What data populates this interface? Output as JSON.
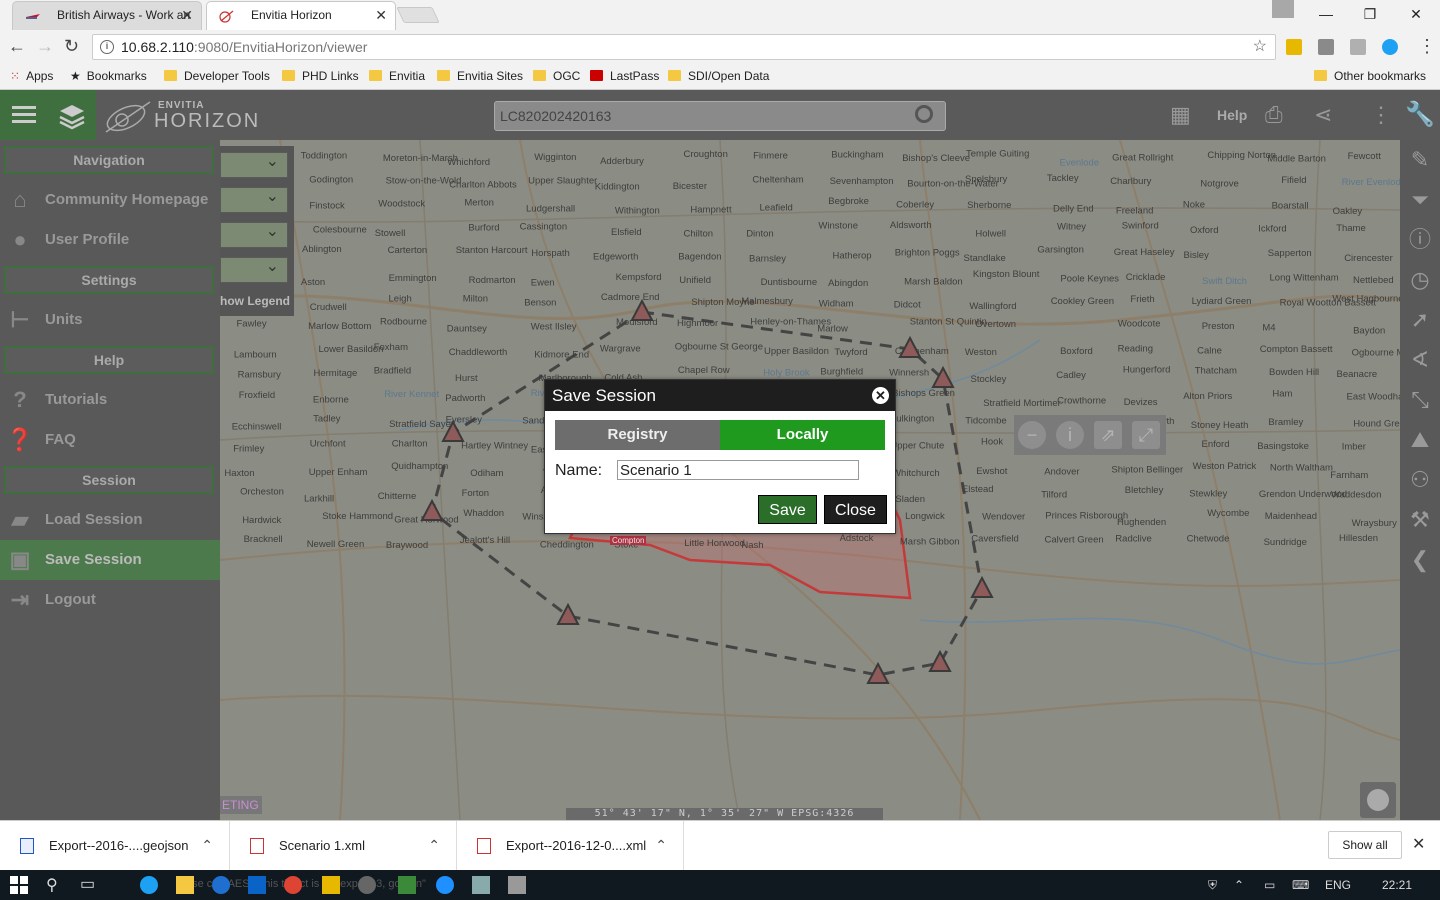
{
  "browser": {
    "tabs": [
      {
        "label": "British Airways - Work an"
      },
      {
        "label": "Envitia Horizon"
      }
    ],
    "url": {
      "host": "10.68.2.110",
      "rest": ":9080/EnvitiaHorizon/viewer"
    },
    "bookmarks": [
      {
        "label": "Apps"
      },
      {
        "label": "Bookmarks"
      },
      {
        "label": "Developer Tools"
      },
      {
        "label": "PHD Links"
      },
      {
        "label": "Envitia"
      },
      {
        "label": "Envitia Sites"
      },
      {
        "label": "OGC"
      },
      {
        "label": "LastPass"
      },
      {
        "label": "SDI/Open Data"
      },
      {
        "label": "Other bookmarks"
      }
    ]
  },
  "header": {
    "brand_small": "ENVITIA",
    "brand": "HORIZON",
    "search_value": "LC820202420163",
    "help_label": "Help"
  },
  "sidebar": {
    "sections": {
      "navigation": "Navigation",
      "settings": "Settings",
      "help": "Help",
      "session": "Session"
    },
    "items": {
      "community": "Community Homepage",
      "profile": "User Profile",
      "units": "Units",
      "tutorials": "Tutorials",
      "faq": "FAQ",
      "load": "Load Session",
      "save": "Save Session",
      "logout": "Logout"
    }
  },
  "map": {
    "show_legend": "how Legend",
    "coords": "51° 43' 17\" N,   1° 35' 27\" W    EPSG:4326",
    "eting": "ETING",
    "places": [
      {
        "name": "Alstone"
      },
      {
        "name": "Toddington"
      },
      {
        "name": "Moreton-in-Marsh"
      },
      {
        "name": "Whichford"
      },
      {
        "name": "Wigginton"
      },
      {
        "name": "Adderbury"
      },
      {
        "name": "Croughton"
      },
      {
        "name": "Finmere"
      },
      {
        "name": "Buckingham"
      },
      {
        "name": "Bishop's Cleeve"
      },
      {
        "name": "Temple Guiting"
      },
      {
        "name": "Evenlode"
      },
      {
        "name": "Great Rollright"
      },
      {
        "name": "Chipping Norton"
      },
      {
        "name": "Middle Barton"
      },
      {
        "name": "Fewcott"
      },
      {
        "name": "Newton Morrell"
      },
      {
        "name": "Godington"
      },
      {
        "name": "Stow-on-the-Wold"
      },
      {
        "name": "Charlton Abbots"
      },
      {
        "name": "Upper Slaughter"
      },
      {
        "name": "Kiddington"
      },
      {
        "name": "Bicester"
      },
      {
        "name": "Cheltenham"
      },
      {
        "name": "Sevenhampton"
      },
      {
        "name": "Bourton-on-the-Water"
      },
      {
        "name": "Spelsbury"
      },
      {
        "name": "Tackley"
      },
      {
        "name": "Charlbury"
      },
      {
        "name": "Notgrove"
      },
      {
        "name": "Fifield"
      },
      {
        "name": "River Evenlode"
      },
      {
        "name": "Shipton"
      },
      {
        "name": "Finstock"
      },
      {
        "name": "Woodstock"
      },
      {
        "name": "Merton"
      },
      {
        "name": "Ludgershall"
      },
      {
        "name": "Withington"
      },
      {
        "name": "Hampnett"
      },
      {
        "name": "Leafield"
      },
      {
        "name": "Begbroke"
      },
      {
        "name": "Coberley"
      },
      {
        "name": "Sherborne"
      },
      {
        "name": "Delly End"
      },
      {
        "name": "Freeland"
      },
      {
        "name": "Noke"
      },
      {
        "name": "Boarstall"
      },
      {
        "name": "Oakley"
      },
      {
        "name": "Aylesbury"
      },
      {
        "name": "Colesbourne"
      },
      {
        "name": "Stowell"
      },
      {
        "name": "Burford"
      },
      {
        "name": "Cassington"
      },
      {
        "name": "Elsfield"
      },
      {
        "name": "Chilton"
      },
      {
        "name": "Dinton"
      },
      {
        "name": "Winstone"
      },
      {
        "name": "Aldsworth"
      },
      {
        "name": "Holwell"
      },
      {
        "name": "Witney"
      },
      {
        "name": "Swinford"
      },
      {
        "name": "Oxford"
      },
      {
        "name": "Ickford"
      },
      {
        "name": "Thame"
      },
      {
        "name": "Calmsden"
      },
      {
        "name": "Ablington"
      },
      {
        "name": "Carterton"
      },
      {
        "name": "Stanton Harcourt"
      },
      {
        "name": "Horspath"
      },
      {
        "name": "Edgeworth"
      },
      {
        "name": "Bagendon"
      },
      {
        "name": "Barnsley"
      },
      {
        "name": "Hatherop"
      },
      {
        "name": "Brighton Poggs"
      },
      {
        "name": "Standlake"
      },
      {
        "name": "Garsington"
      },
      {
        "name": "Great Haseley"
      },
      {
        "name": "Bisley"
      },
      {
        "name": "Sapperton"
      },
      {
        "name": "Cirencester"
      },
      {
        "name": "Coates"
      },
      {
        "name": "Aston"
      },
      {
        "name": "Emmington"
      },
      {
        "name": "Rodmarton"
      },
      {
        "name": "Ewen"
      },
      {
        "name": "Kempsford"
      },
      {
        "name": "Unifield"
      },
      {
        "name": "Duntisbourne"
      },
      {
        "name": "Abingdon"
      },
      {
        "name": "Marsh Baldon"
      },
      {
        "name": "Kingston Blount"
      },
      {
        "name": "Poole Keynes"
      },
      {
        "name": "Cricklade"
      },
      {
        "name": "Swift Ditch"
      },
      {
        "name": "Long Wittenham"
      },
      {
        "name": "Nettlebed"
      },
      {
        "name": "Tetbury"
      },
      {
        "name": "Crudwell"
      },
      {
        "name": "Leigh"
      },
      {
        "name": "Milton"
      },
      {
        "name": "Benson"
      },
      {
        "name": "Cadmore End"
      },
      {
        "name": "Shipton Moyne"
      },
      {
        "name": "Malmesbury"
      },
      {
        "name": "Widham"
      },
      {
        "name": "Didcot"
      },
      {
        "name": "Wallingford"
      },
      {
        "name": "Cookley Green"
      },
      {
        "name": "Frieth"
      },
      {
        "name": "Lydiard Green"
      },
      {
        "name": "Royal Wootton Bassett"
      },
      {
        "name": "West Hagbourne"
      },
      {
        "name": "Fawley"
      },
      {
        "name": "Marlow Bottom"
      },
      {
        "name": "Rodbourne"
      },
      {
        "name": "Dauntsey"
      },
      {
        "name": "West Ilsley"
      },
      {
        "name": "Moulsford"
      },
      {
        "name": "Highmoor"
      },
      {
        "name": "Henley-on-Thames"
      },
      {
        "name": "Marlow"
      },
      {
        "name": "Stanton St Quintin"
      },
      {
        "name": "Overtown"
      },
      {
        "name": "Compton"
      },
      {
        "name": "Woodcote"
      },
      {
        "name": "Preston"
      },
      {
        "name": "M4"
      },
      {
        "name": "Baydon"
      },
      {
        "name": "Lambourn"
      },
      {
        "name": "Lower Basildon"
      },
      {
        "name": "Foxham"
      },
      {
        "name": "Chaddleworth"
      },
      {
        "name": "Kidmore End"
      },
      {
        "name": "Wargrave"
      },
      {
        "name": "Ogbourne St George"
      },
      {
        "name": "Upper Basildon"
      },
      {
        "name": "Twyford"
      },
      {
        "name": "Chippenham"
      },
      {
        "name": "Weston"
      },
      {
        "name": "Boxford"
      },
      {
        "name": "Reading"
      },
      {
        "name": "Calne"
      },
      {
        "name": "Compton Bassett"
      },
      {
        "name": "Ogbourne Maizey"
      },
      {
        "name": "Ramsbury"
      },
      {
        "name": "Hermitage"
      },
      {
        "name": "Bradfield"
      },
      {
        "name": "Hurst"
      },
      {
        "name": "Marlborough"
      },
      {
        "name": "Cold Ash"
      },
      {
        "name": "Chapel Row"
      },
      {
        "name": "Holy Brook"
      },
      {
        "name": "Burghfield"
      },
      {
        "name": "Winnersh"
      },
      {
        "name": "Stockley"
      },
      {
        "name": "Cadley"
      },
      {
        "name": "Hungerford"
      },
      {
        "name": "Thatcham"
      },
      {
        "name": "Bowden Hill"
      },
      {
        "name": "Beanacre"
      },
      {
        "name": "Froxfield"
      },
      {
        "name": "Enborne"
      },
      {
        "name": "River Kennet"
      },
      {
        "name": "Padworth"
      },
      {
        "name": "River Loddon"
      },
      {
        "name": "Barkham"
      },
      {
        "name": "Melksham"
      },
      {
        "name": "Chisbury"
      },
      {
        "name": "Inkpen"
      },
      {
        "name": "Bishops Green"
      },
      {
        "name": "Stratfield Mortimer"
      },
      {
        "name": "Crowthorne"
      },
      {
        "name": "Devizes"
      },
      {
        "name": "Alton Priors"
      },
      {
        "name": "Ham"
      },
      {
        "name": "East Woodhay"
      },
      {
        "name": "Ecchinswell"
      },
      {
        "name": "Tadley"
      },
      {
        "name": "Stratfield Saye"
      },
      {
        "name": "Eversley"
      },
      {
        "name": "Sandhurst"
      },
      {
        "name": "Avon"
      },
      {
        "name": "Seend Cleeve"
      },
      {
        "name": "Burbage"
      },
      {
        "name": "Woodborough"
      },
      {
        "name": "Bulkington"
      },
      {
        "name": "Tidcombe"
      },
      {
        "name": "Little Down"
      },
      {
        "name": "Ashmansworth"
      },
      {
        "name": "Stoney Heath"
      },
      {
        "name": "Bramley"
      },
      {
        "name": "Hound Green"
      },
      {
        "name": "Frimley"
      },
      {
        "name": "Urchfont"
      },
      {
        "name": "Charlton"
      },
      {
        "name": "Hartley Wintney"
      },
      {
        "name": "Easterton"
      },
      {
        "name": "Hannington"
      },
      {
        "name": "Sherborne St John"
      },
      {
        "name": "Coulston"
      },
      {
        "name": "Everleigh"
      },
      {
        "name": "Upper Chute"
      },
      {
        "name": "Hook"
      },
      {
        "name": "Fleet"
      },
      {
        "name": "Farnborough"
      },
      {
        "name": "Enford"
      },
      {
        "name": "Basingstoke"
      },
      {
        "name": "Imber"
      },
      {
        "name": "Haxton"
      },
      {
        "name": "Upper Enham"
      },
      {
        "name": "Quidhampton"
      },
      {
        "name": "Odiham"
      },
      {
        "name": "Aldershot"
      },
      {
        "name": "Tidworth"
      },
      {
        "name": "Appleshaw"
      },
      {
        "name": "Tilshead"
      },
      {
        "name": "Figheldean"
      },
      {
        "name": "Whitchurch"
      },
      {
        "name": "Ewshot"
      },
      {
        "name": "Andover"
      },
      {
        "name": "Shipton Bellinger"
      },
      {
        "name": "Weston Patrick"
      },
      {
        "name": "North Waltham"
      },
      {
        "name": "Farnham"
      },
      {
        "name": "Orcheston"
      },
      {
        "name": "Larkhill"
      },
      {
        "name": "Chitterne"
      },
      {
        "name": "Forton"
      },
      {
        "name": "Abbotts Ann"
      },
      {
        "name": "Holt Pound"
      },
      {
        "name": "Knook"
      },
      {
        "name": "Amesbury"
      },
      {
        "name": "Sutton Scotney"
      },
      {
        "name": "Sladen"
      },
      {
        "name": "Elstead"
      },
      {
        "name": "Tilford"
      },
      {
        "name": "Bletchley"
      },
      {
        "name": "Stewkley"
      },
      {
        "name": "Grendon Underwood"
      },
      {
        "name": "Waddesdon"
      },
      {
        "name": "Hardwick"
      },
      {
        "name": "Stoke Hammond"
      },
      {
        "name": "Great Horwood"
      },
      {
        "name": "Whaddon"
      },
      {
        "name": "Winslow"
      },
      {
        "name": "Granborough"
      },
      {
        "name": "Creslow"
      },
      {
        "name": "Wingrave"
      },
      {
        "name": "Aston Sandford"
      },
      {
        "name": "Longwick"
      },
      {
        "name": "Wendover"
      },
      {
        "name": "Princes Risborough"
      },
      {
        "name": "Hughenden"
      },
      {
        "name": "Wycombe"
      },
      {
        "name": "Maidenhead"
      },
      {
        "name": "Wraysbury"
      },
      {
        "name": "Bracknell"
      },
      {
        "name": "Newell Green"
      },
      {
        "name": "Braywood"
      },
      {
        "name": "Jealott's Hill"
      },
      {
        "name": "Cheddington"
      },
      {
        "name": "Stoke"
      },
      {
        "name": "Little Horwood"
      },
      {
        "name": "Nash"
      },
      {
        "name": "Adstock"
      },
      {
        "name": "Marsh Gibbon"
      },
      {
        "name": "Caversfield"
      },
      {
        "name": "Calvert Green"
      },
      {
        "name": "Radclive"
      },
      {
        "name": "Chetwode"
      },
      {
        "name": "Sundridge"
      },
      {
        "name": "Hillesden"
      }
    ]
  },
  "modal": {
    "title": "Save Session",
    "tab_registry": "Registry",
    "tab_locally": "Locally",
    "name_label": "Name:",
    "name_value": "Scenario 1",
    "save_label": "Save",
    "close_label": "Close"
  },
  "downloads": [
    {
      "label": "Export--2016-....geojson"
    },
    {
      "label": "Scenario 1.xml"
    },
    {
      "label": "Export--2016-12-0....xml"
    }
  ],
  "downloads_show_all": "Show all",
  "taskbar": {
    "lang": "ENG",
    "time": "22:21",
    "ghost_text": "ase ctor AES s this the ct is ind exp ed 3, got 1\\n\""
  }
}
